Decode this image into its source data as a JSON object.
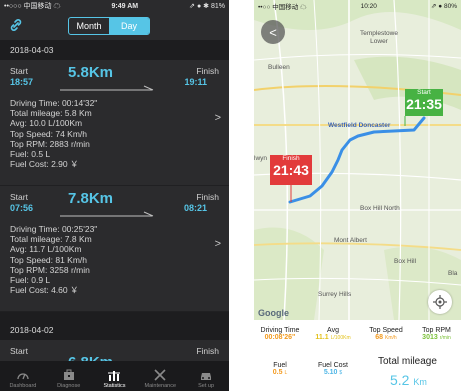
{
  "left": {
    "status": {
      "carrier": "••○○○ 中国移动 ☁",
      "time": "9:49 AM",
      "battery": "⇗ ● ✱ 81%"
    },
    "toggle": {
      "month": "Month",
      "day": "Day",
      "active": "Day"
    },
    "days": [
      {
        "date": "2018-04-03",
        "trips": [
          {
            "start_label": "Start",
            "finish_label": "Finish",
            "start_time": "18:57",
            "finish_time": "19:11",
            "distance": "5.8Km",
            "stats": [
              "Driving Time: 00:14'32\"",
              "Total mileage: 5.8 Km",
              "Avg: 10.0 L/100Km",
              "Top Speed: 74 Km/h",
              "Top RPM: 2883 r/min",
              "Fuel: 0.5 L",
              "Fuel Cost: 2.90 ￥"
            ]
          },
          {
            "start_label": "Start",
            "finish_label": "Finish",
            "start_time": "07:56",
            "finish_time": "08:21",
            "distance": "7.8Km",
            "stats": [
              "Driving Time: 00:25'23\"",
              "Total mileage: 7.8 Km",
              "Avg: 11.7 L/100Km",
              "Top Speed: 81 Km/h",
              "Top RPM: 3258 r/min",
              "Fuel: 0.9 L",
              "Fuel Cost: 4.60 ￥"
            ]
          }
        ]
      },
      {
        "date": "2018-04-02",
        "trips": [
          {
            "start_label": "Start",
            "finish_label": "Finish",
            "distance": "6.8Km"
          }
        ]
      }
    ],
    "tabs": [
      "Dashboard",
      "Diagnose",
      "Statistics",
      "Maintenance",
      "Set up"
    ],
    "active_tab": "Statistics",
    "accent": "#56c5e6"
  },
  "right": {
    "status": {
      "carrier": "••○○ 中国移动 ☁",
      "time": "10:20",
      "battery": "⇗ ● 80%"
    },
    "map_labels": {
      "templestowe": "Templestowe\nLower",
      "bulleen": "Bulleen",
      "westfield": "Westfield Doncaster",
      "box_hill_north": "Box Hill North",
      "mont_albert": "Mont Albert",
      "box_hill": "Box Hill",
      "surrey_hills": "Surrey Hills",
      "balwyn": "lwyn",
      "bla": "Bla"
    },
    "start_flag": {
      "label": "Start",
      "time": "21:35"
    },
    "finish_flag": {
      "label": "Finish",
      "time": "21:43"
    },
    "google": "Google",
    "stats": {
      "driving_time": {
        "label": "Driving Time",
        "value": "00:08'26\""
      },
      "avg": {
        "label": "Avg",
        "value": "11.1",
        "unit": "L/100Km"
      },
      "top_speed": {
        "label": "Top Speed",
        "value": "68",
        "unit": "Km/h"
      },
      "top_rpm": {
        "label": "Top RPM",
        "value": "3013",
        "unit": "r/min"
      },
      "fuel": {
        "label": "Fuel",
        "value": "0.5",
        "unit": "L"
      },
      "fuel_cost": {
        "label": "Fuel Cost",
        "value": "5.10",
        "unit": "$"
      },
      "total_mileage": {
        "label": "Total mileage",
        "value": "5.2",
        "unit": "Km"
      }
    },
    "colors": {
      "route": "#3a8fe6",
      "start": "#47b243",
      "finish": "#e23b3b"
    }
  }
}
